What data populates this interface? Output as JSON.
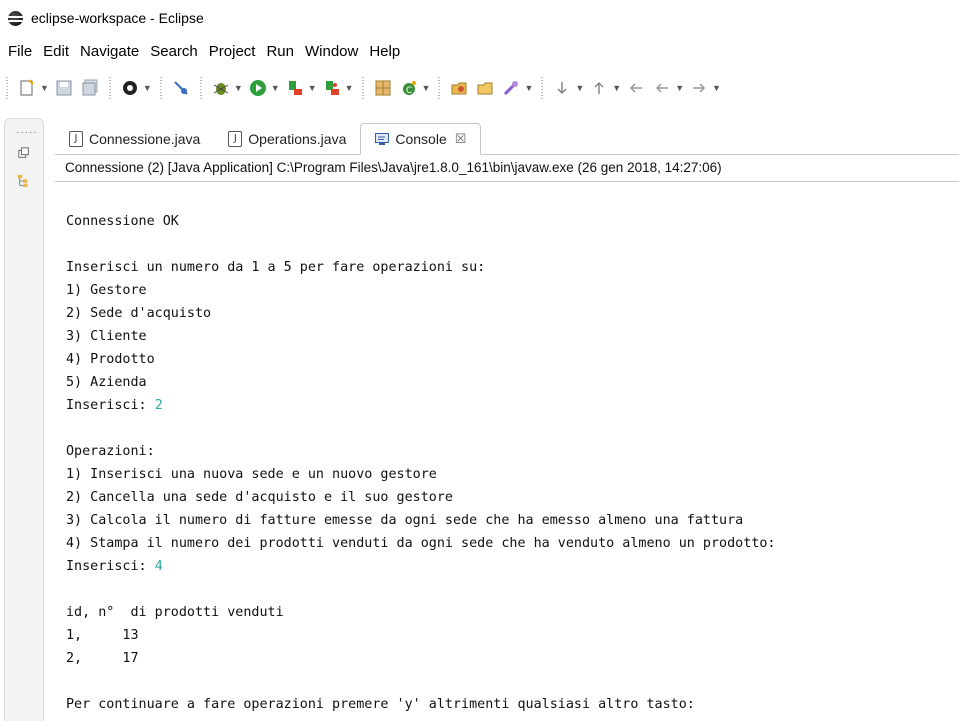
{
  "window": {
    "title": "eclipse-workspace - Eclipse"
  },
  "menubar": {
    "items": [
      "File",
      "Edit",
      "Navigate",
      "Search",
      "Project",
      "Run",
      "Window",
      "Help"
    ]
  },
  "toolbar": {
    "icons": [
      "new-icon",
      "save-icon",
      "save-all-icon",
      "target-icon",
      "skip-breakpoints-icon",
      "debug-icon",
      "run-icon",
      "run-last-icon",
      "external-tools-icon",
      "new-java-project-icon",
      "new-class-icon",
      "open-type-icon",
      "open-task-icon",
      "search-icon",
      "next-annotation-icon",
      "prev-annotation-icon",
      "back-icon",
      "forward-icon"
    ]
  },
  "tabs": [
    {
      "label": "Connessione.java",
      "active": false
    },
    {
      "label": "Operations.java",
      "active": false
    },
    {
      "label": "Console",
      "active": true,
      "close": "☒"
    }
  ],
  "console": {
    "launch_description": "Connessione (2) [Java Application] C:\\Program Files\\Java\\jre1.8.0_161\\bin\\javaw.exe (26 gen 2018, 14:27:06)",
    "lines": [
      "Connessione OK",
      "",
      "Inserisci un numero da 1 a 5 per fare operazioni su:",
      "1) Gestore",
      "2) Sede d'acquisto",
      "3) Cliente",
      "4) Prodotto",
      "5) Azienda",
      "Inserisci: ",
      "",
      "Operazioni:",
      "1) Inserisci una nuova sede e un nuovo gestore",
      "2) Cancella una sede d'acquisto e il suo gestore",
      "3) Calcola il numero di fatture emesse da ogni sede che ha emesso almeno una fattura",
      "4) Stampa il numero dei prodotti venduti da ogni sede che ha venduto almeno un prodotto:",
      "Inserisci: ",
      "",
      "id, n°  di prodotti venduti",
      "1,     13",
      "2,     17",
      "",
      "Per continuare a fare operazioni premere 'y' altrimenti qualsiasi altro tasto:"
    ],
    "input1": "2",
    "input2": "4"
  },
  "colors": {
    "input": "#2eaa9b"
  }
}
